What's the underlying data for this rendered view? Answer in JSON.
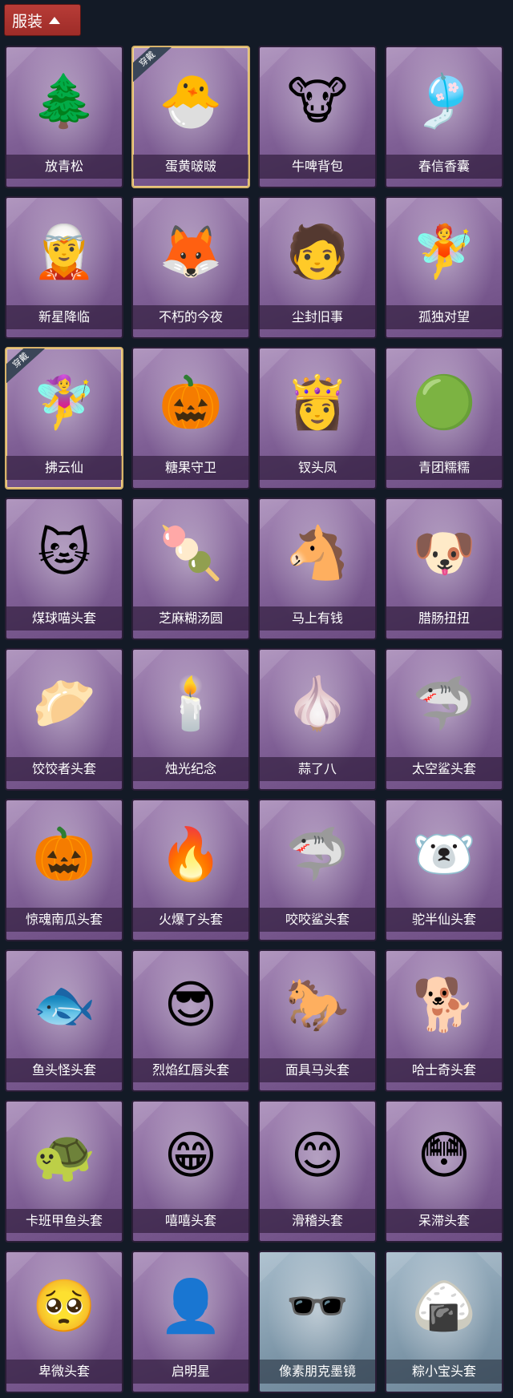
{
  "header": {
    "label": "服装",
    "icon": "chevron-up-icon"
  },
  "status_badge_label": "穿戴",
  "items": [
    {
      "name": "放青松",
      "icon": "potted-pine-icon",
      "emoji": "🌲",
      "theme": "purple",
      "equipped": false
    },
    {
      "name": "蛋黄啵啵",
      "icon": "chick-egg-icon",
      "emoji": "🐣",
      "theme": "purple",
      "equipped": true
    },
    {
      "name": "牛啤背包",
      "icon": "cow-barrel-icon",
      "emoji": "🐮",
      "theme": "purple",
      "equipped": false
    },
    {
      "name": "春信香囊",
      "icon": "sachet-icon",
      "emoji": "🎐",
      "theme": "purple",
      "equipped": false
    },
    {
      "name": "新星降临",
      "icon": "star-doll-keychain-icon",
      "emoji": "🧝",
      "theme": "purple",
      "equipped": false
    },
    {
      "name": "不朽的今夜",
      "icon": "pink-fox-keychain-icon",
      "emoji": "🦊",
      "theme": "purple",
      "equipped": false
    },
    {
      "name": "尘封旧事",
      "icon": "dark-hair-doll-icon",
      "emoji": "🧑",
      "theme": "purple",
      "equipped": false
    },
    {
      "name": "孤独对望",
      "icon": "white-hair-doll-icon",
      "emoji": "🧚",
      "theme": "purple",
      "equipped": false
    },
    {
      "name": "拂云仙",
      "icon": "fairy-keychain-icon",
      "emoji": "🧚‍♀️",
      "theme": "purple",
      "equipped": true
    },
    {
      "name": "糖果守卫",
      "icon": "pumpkin-scarecrow-icon",
      "emoji": "🎃",
      "theme": "purple",
      "equipped": false
    },
    {
      "name": "钗头凤",
      "icon": "phoenix-crown-doll-icon",
      "emoji": "👸",
      "theme": "purple",
      "equipped": false
    },
    {
      "name": "青团糯糯",
      "icon": "green-dumpling-icon",
      "emoji": "🟢",
      "theme": "purple",
      "equipped": false
    },
    {
      "name": "煤球喵头套",
      "icon": "black-cat-head-icon",
      "emoji": "🐱",
      "theme": "purple",
      "equipped": false
    },
    {
      "name": "芝麻糊汤圆",
      "icon": "white-dumpling-head-icon",
      "emoji": "🍡",
      "theme": "purple",
      "equipped": false
    },
    {
      "name": "马上有钱",
      "icon": "red-horse-head-icon",
      "emoji": "🐴",
      "theme": "purple",
      "equipped": false
    },
    {
      "name": "腊肠扭扭",
      "icon": "dachshund-head-icon",
      "emoji": "🐶",
      "theme": "purple",
      "equipped": false
    },
    {
      "name": "饺饺者头套",
      "icon": "dumpling-cloud-head-icon",
      "emoji": "🥟",
      "theme": "purple",
      "equipped": false
    },
    {
      "name": "烛光纪念",
      "icon": "candle-head-icon",
      "emoji": "🕯️",
      "theme": "purple",
      "equipped": false
    },
    {
      "name": "蒜了八",
      "icon": "garlic-head-icon",
      "emoji": "🧄",
      "theme": "purple",
      "equipped": false
    },
    {
      "name": "太空鲨头套",
      "icon": "space-shark-head-icon",
      "emoji": "🦈",
      "theme": "purple",
      "equipped": false
    },
    {
      "name": "惊魂南瓜头套",
      "icon": "pumpkin-head-icon",
      "emoji": "🎃",
      "theme": "purple",
      "equipped": false
    },
    {
      "name": "火爆了头套",
      "icon": "fire-head-icon",
      "emoji": "🔥",
      "theme": "purple",
      "equipped": false
    },
    {
      "name": "咬咬鲨头套",
      "icon": "biting-shark-head-icon",
      "emoji": "🦈",
      "theme": "purple",
      "equipped": false
    },
    {
      "name": "驼半仙头套",
      "icon": "sunglasses-bear-head-icon",
      "emoji": "🐻‍❄️",
      "theme": "purple",
      "equipped": false
    },
    {
      "name": "鱼头怪头套",
      "icon": "fish-head-icon",
      "emoji": "🐟",
      "theme": "purple",
      "equipped": false
    },
    {
      "name": "烈焰红唇头套",
      "icon": "yellow-mascot-sunglasses-icon",
      "emoji": "😎",
      "theme": "purple",
      "equipped": false
    },
    {
      "name": "面具马头套",
      "icon": "horse-mask-head-icon",
      "emoji": "🐎",
      "theme": "purple",
      "equipped": false
    },
    {
      "name": "哈士奇头套",
      "icon": "husky-sunglasses-head-icon",
      "emoji": "🐕",
      "theme": "purple",
      "equipped": false
    },
    {
      "name": "卡班甲鱼头套",
      "icon": "turtle-head-icon",
      "emoji": "🐢",
      "theme": "purple",
      "equipped": false
    },
    {
      "name": "嘻嘻头套",
      "icon": "grin-emoji-head-icon",
      "emoji": "😁",
      "theme": "purple",
      "equipped": false
    },
    {
      "name": "滑稽头套",
      "icon": "funny-emoji-head-icon",
      "emoji": "😊",
      "theme": "purple",
      "equipped": false
    },
    {
      "name": "呆滞头套",
      "icon": "dazed-emoji-head-icon",
      "emoji": "😳",
      "theme": "purple",
      "equipped": false
    },
    {
      "name": "卑微头套",
      "icon": "humble-emoji-head-icon",
      "emoji": "🥺",
      "theme": "purple",
      "equipped": false
    },
    {
      "name": "启明星",
      "icon": "bald-mannequin-icon",
      "emoji": "👤",
      "theme": "purple",
      "equipped": false
    },
    {
      "name": "像素朋克墨镜",
      "icon": "pixel-sunglasses-icon",
      "emoji": "🕶️",
      "theme": "blue",
      "equipped": false
    },
    {
      "name": "粽小宝头套",
      "icon": "zongzi-head-icon",
      "emoji": "🍙",
      "theme": "blue",
      "equipped": false
    }
  ]
}
